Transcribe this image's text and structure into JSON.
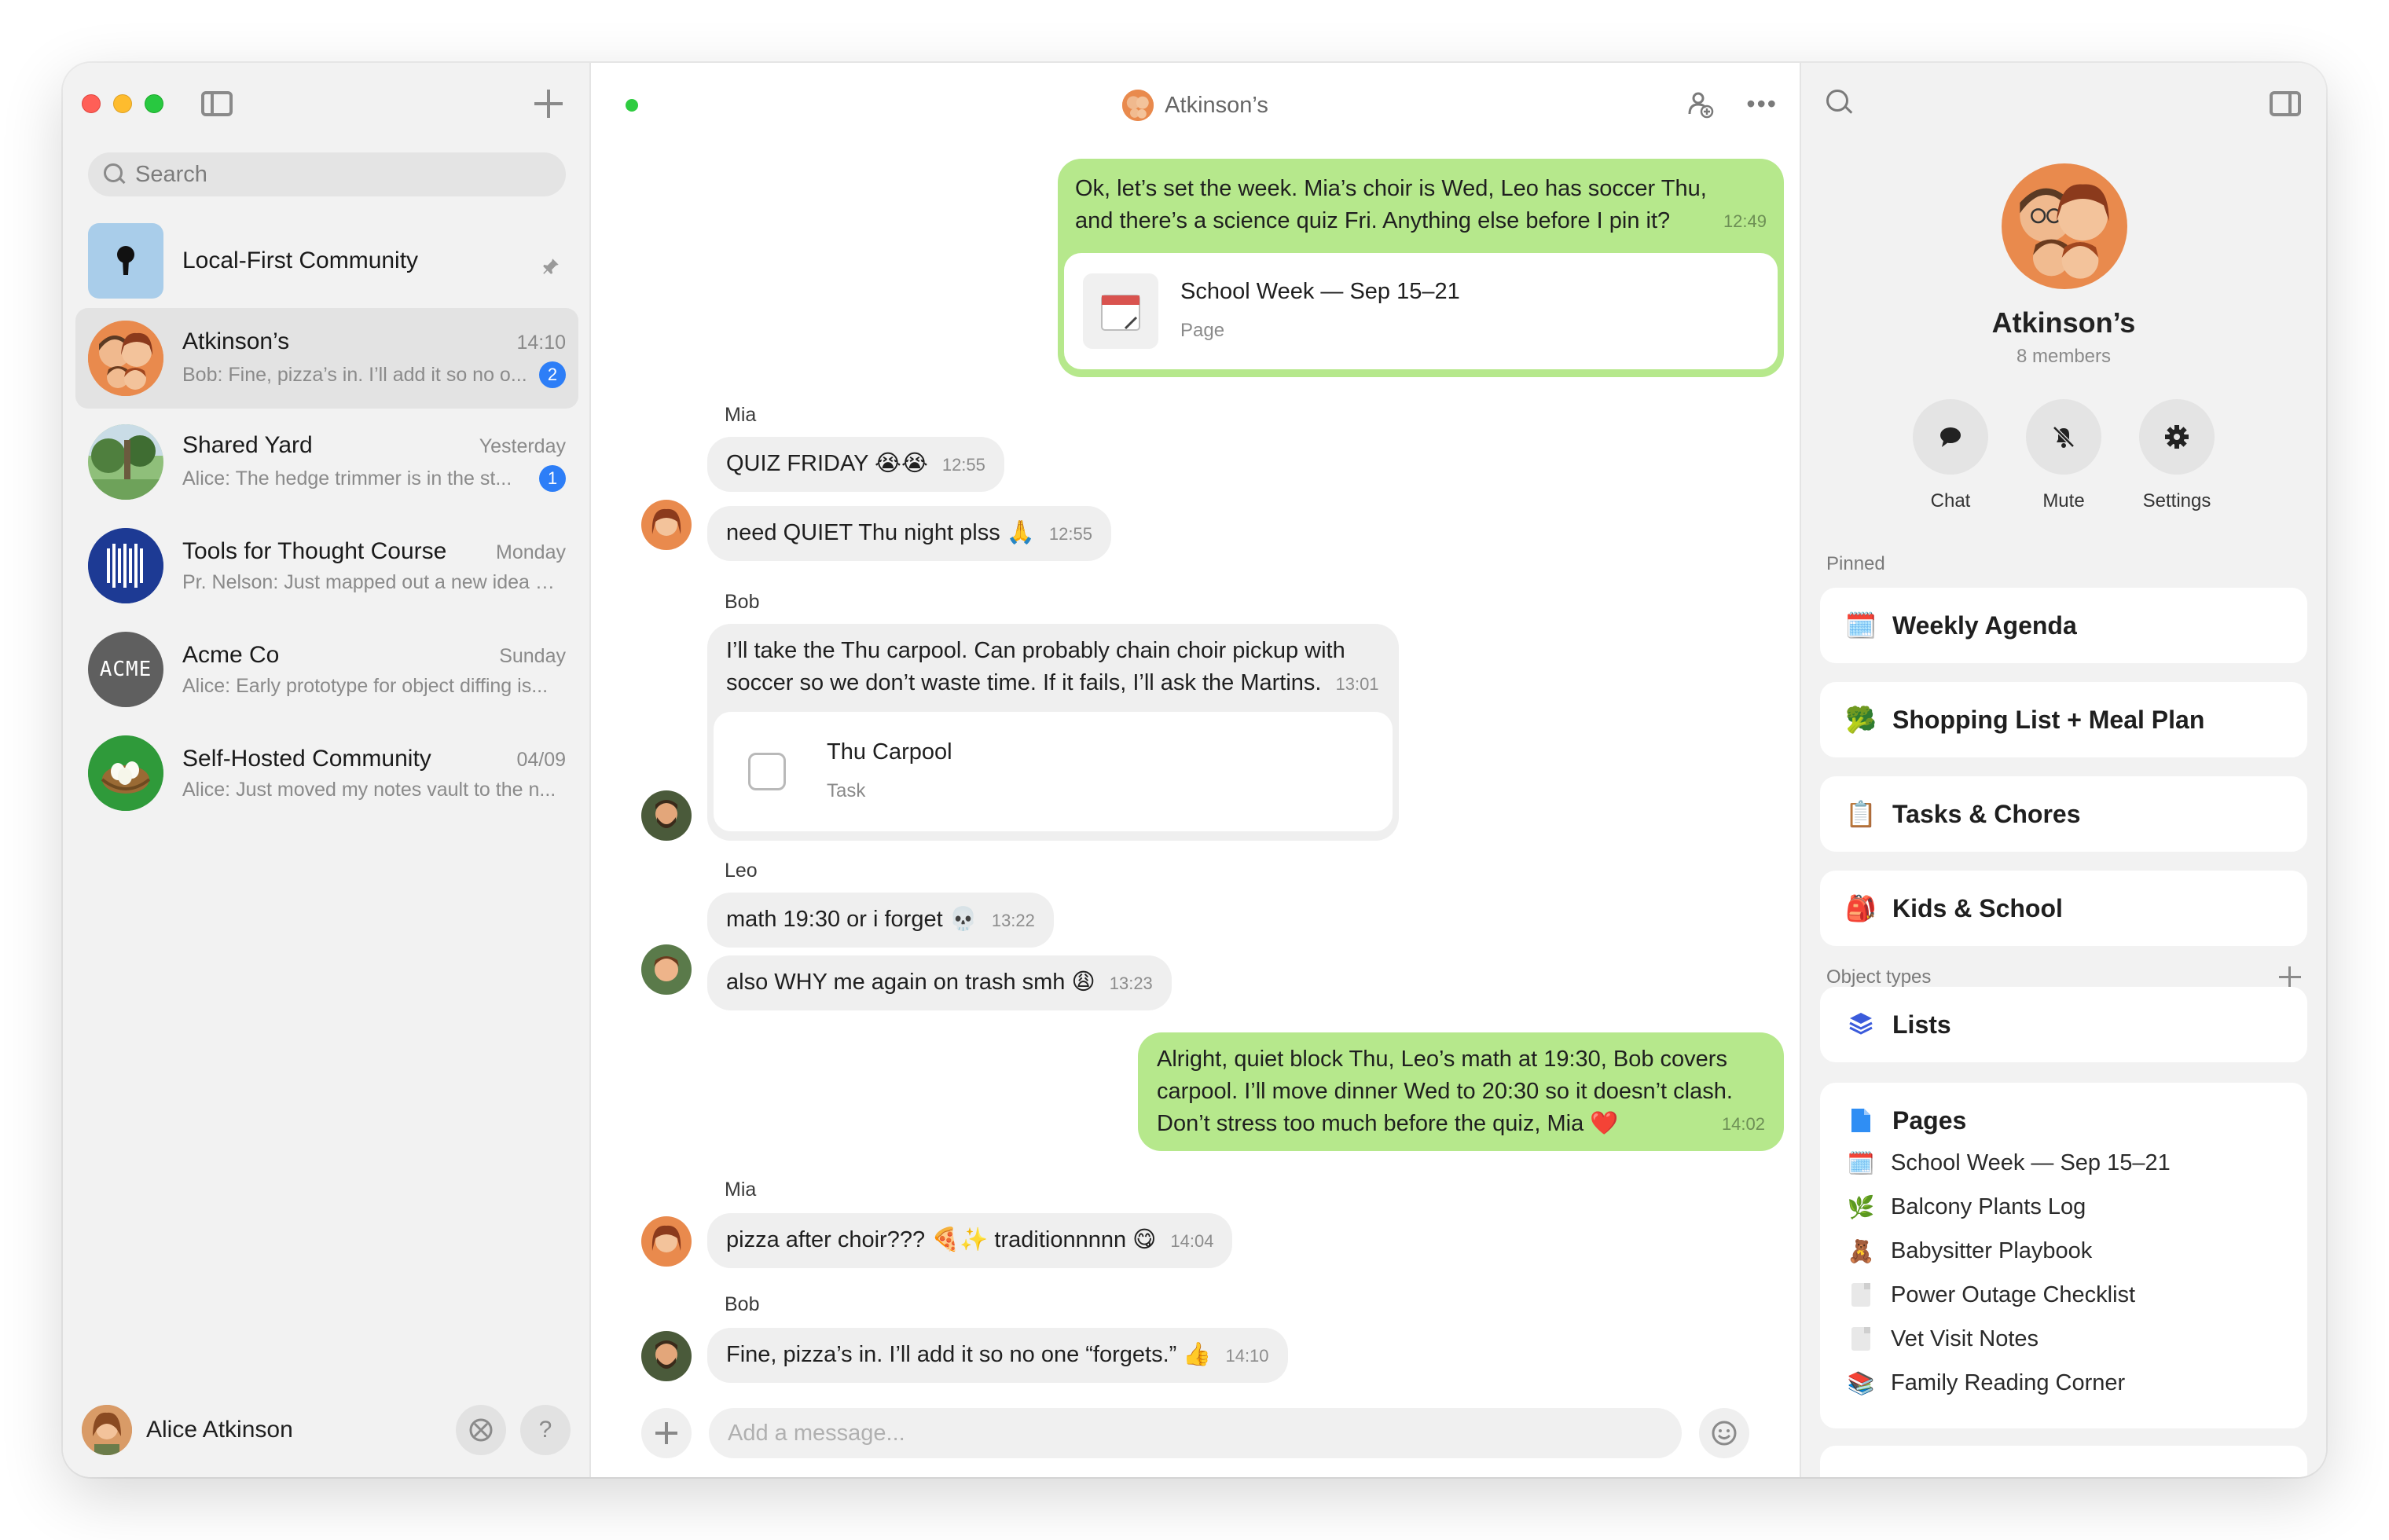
{
  "sidebar": {
    "search_placeholder": "Search",
    "chats": [
      {
        "name": "Local-First Community",
        "time": "",
        "preview": "",
        "badge": "",
        "pinned": true
      },
      {
        "name": "Atkinson’s",
        "time": "14:10",
        "preview": "Bob: Fine, pizza’s in. I’ll add it so no o...",
        "badge": "2"
      },
      {
        "name": "Shared Yard",
        "time": "Yesterday",
        "preview": "Alice: The hedge trimmer is in the st...",
        "badge": "1"
      },
      {
        "name": "Tools for Thought Course",
        "time": "Monday",
        "preview": "Pr. Nelson: Just mapped out a new idea s...",
        "badge": ""
      },
      {
        "name": "Acme Co",
        "time": "Sunday",
        "preview": "Alice: Early prototype for object diffing is...",
        "badge": "",
        "avatar_text": "ACME"
      },
      {
        "name": "Self-Hosted Community",
        "time": "04/09",
        "preview": "Alice: Just moved my notes vault to the n...",
        "badge": ""
      }
    ],
    "user_name": "Alice Atkinson",
    "help_label": "?"
  },
  "header": {
    "title": "Atkinson’s"
  },
  "messages": {
    "m1": {
      "text": "Ok, let’s set the week. Mia’s choir is Wed, Leo has soccer Thu,",
      "text2": "and there’s a science quiz Fri. Anything else before I pin it?",
      "time": "12:49",
      "card_title": "School Week — Sep 15–21",
      "card_sub": "Page"
    },
    "s_mia1": "Mia",
    "m2": {
      "text": "QUIZ FRIDAY 😭😭",
      "time": "12:55"
    },
    "m3": {
      "text": "need QUIET Thu night plss 🙏",
      "time": "12:55"
    },
    "s_bob1": "Bob",
    "m4": {
      "text": "I’ll take the Thu carpool. Can probably chain choir pickup with",
      "text2": "soccer so we don’t waste time. If it fails, I’ll ask the Martins.",
      "time": "13:01",
      "card_title": "Thu Carpool",
      "card_sub": "Task"
    },
    "s_leo": "Leo",
    "m5": {
      "text": "math 19:30 or i forget 💀",
      "time": "13:22"
    },
    "m6": {
      "text": "also WHY me again on trash smh 😩",
      "time": "13:23"
    },
    "m7": {
      "text": "Alright, quiet block Thu, Leo’s math at 19:30, Bob covers",
      "text2": "carpool. I’ll move dinner Wed to 20:30 so it doesn’t clash.",
      "text3": "Don’t stress too much before the quiz, Mia ❤️",
      "time": "14:02"
    },
    "s_mia2": "Mia",
    "m8": {
      "text": "pizza after choir??? 🍕✨ traditionnnnn 😋",
      "time": "14:04"
    },
    "s_bob2": "Bob",
    "m9": {
      "text": "Fine, pizza’s in. I’ll add it so no one “forgets.” 👍",
      "time": "14:10"
    }
  },
  "composer": {
    "placeholder": "Add a message..."
  },
  "panel": {
    "group_name": "Atkinson’s",
    "members": "8 members",
    "actions": {
      "chat": "Chat",
      "mute": "Mute",
      "settings": "Settings"
    },
    "pinned_label": "Pinned",
    "pinned": [
      {
        "emoji": "🗓️",
        "label": "Weekly Agenda"
      },
      {
        "emoji": "🥦",
        "label": "Shopping List + Meal Plan"
      },
      {
        "emoji": "📋",
        "label": "Tasks & Chores"
      },
      {
        "emoji": "🎒",
        "label": "Kids & School"
      }
    ],
    "object_types_label": "Object types",
    "lists_label": "Lists",
    "pages_label": "Pages",
    "pages": [
      {
        "emoji": "🗓️",
        "label": "School Week — Sep 15–21"
      },
      {
        "emoji": "🌿",
        "label": "Balcony Plants Log"
      },
      {
        "emoji": "🧸",
        "label": "Babysitter Playbook"
      },
      {
        "emoji": "",
        "label": "Power Outage Checklist"
      },
      {
        "emoji": "",
        "label": "Vet Visit Notes"
      },
      {
        "emoji": "📚",
        "label": "Family Reading Corner"
      }
    ]
  },
  "colors": {
    "accent_blue": "#2d7ef7",
    "outgoing_bubble": "#b6e88c",
    "online": "#2ecc40"
  }
}
